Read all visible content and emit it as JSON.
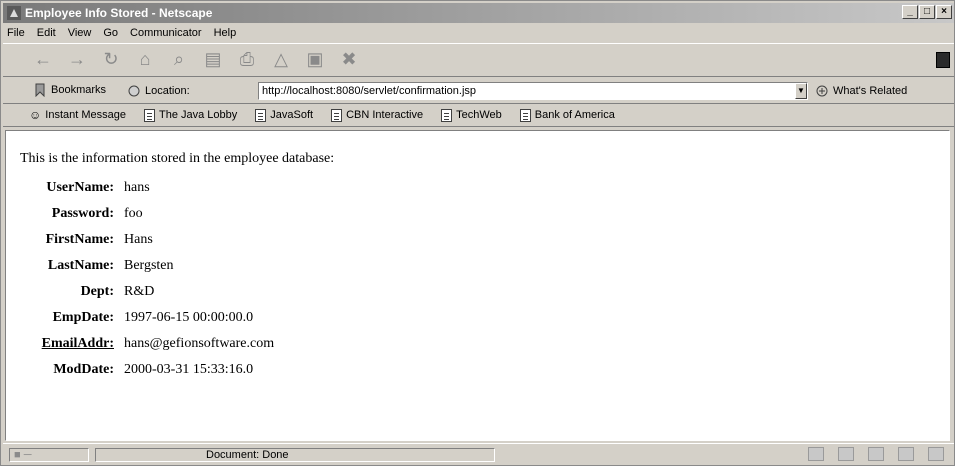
{
  "window": {
    "title": "Employee Info Stored - Netscape",
    "controls": [
      "_",
      "□",
      "×"
    ]
  },
  "menu": [
    "File",
    "Edit",
    "View",
    "Go",
    "Communicator",
    "Help"
  ],
  "nav_icons": [
    "back-icon",
    "forward-icon",
    "reload-icon",
    "home-icon",
    "search-icon",
    "netscape-icon",
    "print-icon",
    "security-icon",
    "shop-icon",
    "stop-icon"
  ],
  "location_bar": {
    "bookmarks_label": "Bookmarks",
    "location_label": "Location:",
    "url": "http://localhost:8080/servlet/confirmation.jsp",
    "related_label": "What's Related"
  },
  "personal_toolbar": [
    "Instant Message",
    "The Java Lobby",
    "JavaSoft",
    "CBN Interactive",
    "TechWeb",
    "Bank of America"
  ],
  "content": {
    "intro": "This is the information stored in the employee database:",
    "fields": [
      {
        "label": "UserName:",
        "value": "hans"
      },
      {
        "label": "Password:",
        "value": "foo"
      },
      {
        "label": "FirstName:",
        "value": "Hans"
      },
      {
        "label": "LastName:",
        "value": "Bergsten"
      },
      {
        "label": "Dept:",
        "value": "R&D"
      },
      {
        "label": "EmpDate:",
        "value": "1997-06-15 00:00:00.0"
      },
      {
        "label": "EmailAddr:",
        "value": "hans@gefionsoftware.com"
      },
      {
        "label": "ModDate:",
        "value": "2000-03-31 15:33:16.0"
      }
    ]
  },
  "status": {
    "text": "Document: Done"
  }
}
